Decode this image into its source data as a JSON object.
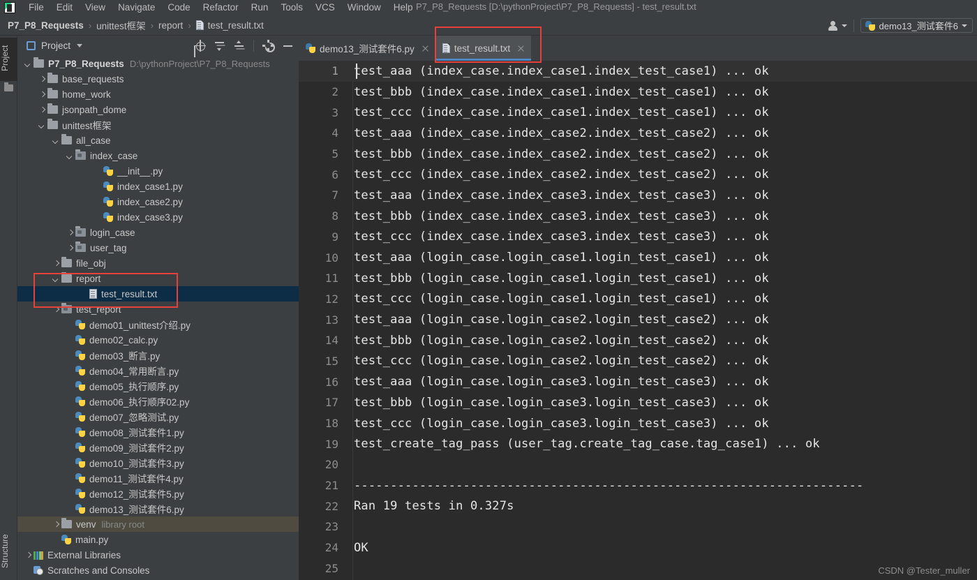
{
  "window": {
    "title": "P7_P8_Requests [D:\\pythonProject\\P7_P8_Requests] - test_result.txt",
    "logo_icon": "pycharm-logo-icon"
  },
  "menubar": {
    "items": [
      {
        "label": "File",
        "mnemonic": "F"
      },
      {
        "label": "Edit",
        "mnemonic": "E"
      },
      {
        "label": "View",
        "mnemonic": "V"
      },
      {
        "label": "Navigate",
        "mnemonic": "N"
      },
      {
        "label": "Code",
        "mnemonic": "C"
      },
      {
        "label": "Refactor",
        "mnemonic": "R"
      },
      {
        "label": "Run",
        "mnemonic": "u"
      },
      {
        "label": "Tools",
        "mnemonic": "T"
      },
      {
        "label": "VCS",
        "mnemonic": "V"
      },
      {
        "label": "Window",
        "mnemonic": "W"
      },
      {
        "label": "Help",
        "mnemonic": "H"
      }
    ]
  },
  "breadcrumb": {
    "separator": "›",
    "items": [
      {
        "label": "P7_P8_Requests",
        "bold": true
      },
      {
        "label": "unittest框架",
        "bold": false
      },
      {
        "label": "report",
        "bold": false
      },
      {
        "label": "test_result.txt",
        "bold": false,
        "icon": "text-file-icon"
      }
    ]
  },
  "toolbar_right": {
    "user_icon": "person-icon",
    "user_caret_icon": "chevron-down-icon",
    "run_config": {
      "icon": "python-file-icon",
      "label": "demo13_测试套件6",
      "caret_icon": "chevron-down-icon"
    }
  },
  "left_strip": {
    "project_tab": "Project",
    "project_tab_icon": "folder-icon",
    "structure_tab": "Structure"
  },
  "project_panel": {
    "icon": "project-view-icon",
    "title": "Project",
    "caret_icon": "chevron-down-icon",
    "actions": [
      {
        "name": "locate-icon",
        "title": "Select Opened File"
      },
      {
        "name": "expand-all-icon",
        "title": "Expand All"
      },
      {
        "name": "collapse-all-icon",
        "title": "Collapse All"
      },
      {
        "name": "gear-icon",
        "title": "Settings"
      },
      {
        "name": "minimize-icon",
        "title": "Hide"
      }
    ],
    "tree": [
      {
        "label": "P7_P8_Requests",
        "path": "D:\\pythonProject\\P7_P8_Requests",
        "indent": 0,
        "arrow": "down",
        "icon": "folder-icon",
        "bold": true,
        "state": "normal"
      },
      {
        "label": "base_requests",
        "indent": 1,
        "arrow": "right",
        "icon": "folder-icon",
        "state": "normal"
      },
      {
        "label": "home_work",
        "indent": 1,
        "arrow": "right",
        "icon": "folder-icon",
        "state": "normal"
      },
      {
        "label": "jsonpath_dome",
        "indent": 1,
        "arrow": "right",
        "icon": "folder-icon",
        "state": "normal"
      },
      {
        "label": "unittest框架",
        "indent": 1,
        "arrow": "down",
        "icon": "folder-icon",
        "state": "normal"
      },
      {
        "label": "all_case",
        "indent": 2,
        "arrow": "down",
        "icon": "folder-icon",
        "state": "normal"
      },
      {
        "label": "index_case",
        "indent": 3,
        "arrow": "down",
        "icon": "source-folder-icon",
        "state": "normal"
      },
      {
        "label": "__init__.py",
        "indent": 5,
        "arrow": "none",
        "icon": "python-file-icon",
        "state": "normal"
      },
      {
        "label": "index_case1.py",
        "indent": 5,
        "arrow": "none",
        "icon": "python-file-icon",
        "state": "normal"
      },
      {
        "label": "index_case2.py",
        "indent": 5,
        "arrow": "none",
        "icon": "python-file-icon",
        "state": "normal"
      },
      {
        "label": "index_case3.py",
        "indent": 5,
        "arrow": "none",
        "icon": "python-file-icon",
        "state": "normal"
      },
      {
        "label": "login_case",
        "indent": 3,
        "arrow": "right",
        "icon": "source-folder-icon",
        "state": "normal"
      },
      {
        "label": "user_tag",
        "indent": 3,
        "arrow": "right",
        "icon": "source-folder-icon",
        "state": "normal"
      },
      {
        "label": "file_obj",
        "indent": 2,
        "arrow": "right",
        "icon": "folder-icon",
        "state": "normal"
      },
      {
        "label": "report",
        "indent": 2,
        "arrow": "down",
        "icon": "folder-icon",
        "state": "normal"
      },
      {
        "label": "test_result.txt",
        "indent": 4,
        "arrow": "none",
        "icon": "text-file-icon",
        "state": "selected"
      },
      {
        "label": "test_report",
        "indent": 2,
        "arrow": "right",
        "icon": "source-folder-icon",
        "state": "normal"
      },
      {
        "label": "demo01_unittest介绍.py",
        "indent": 3,
        "arrow": "none",
        "icon": "python-file-icon",
        "state": "normal"
      },
      {
        "label": "demo02_calc.py",
        "indent": 3,
        "arrow": "none",
        "icon": "python-file-icon",
        "state": "normal"
      },
      {
        "label": "demo03_断言.py",
        "indent": 3,
        "arrow": "none",
        "icon": "python-file-icon",
        "state": "normal"
      },
      {
        "label": "demo04_常用断言.py",
        "indent": 3,
        "arrow": "none",
        "icon": "python-file-icon",
        "state": "normal"
      },
      {
        "label": "demo05_执行顺序.py",
        "indent": 3,
        "arrow": "none",
        "icon": "python-file-icon",
        "state": "normal"
      },
      {
        "label": "demo06_执行顺序02.py",
        "indent": 3,
        "arrow": "none",
        "icon": "python-file-icon",
        "state": "normal"
      },
      {
        "label": "demo07_忽略测试.py",
        "indent": 3,
        "arrow": "none",
        "icon": "python-file-icon",
        "state": "normal"
      },
      {
        "label": "demo08_测试套件1.py",
        "indent": 3,
        "arrow": "none",
        "icon": "python-file-icon",
        "state": "normal"
      },
      {
        "label": "demo09_测试套件2.py",
        "indent": 3,
        "arrow": "none",
        "icon": "python-file-icon",
        "state": "normal"
      },
      {
        "label": "demo10_测试套件3.py",
        "indent": 3,
        "arrow": "none",
        "icon": "python-file-icon",
        "state": "normal"
      },
      {
        "label": "demo11_测试套件4.py",
        "indent": 3,
        "arrow": "none",
        "icon": "python-file-icon",
        "state": "normal"
      },
      {
        "label": "demo12_测试套件5.py",
        "indent": 3,
        "arrow": "none",
        "icon": "python-file-icon",
        "state": "normal"
      },
      {
        "label": "demo13_测试套件6.py",
        "indent": 3,
        "arrow": "none",
        "icon": "python-file-icon",
        "state": "normal"
      },
      {
        "label": "venv",
        "path": "library root",
        "indent": 2,
        "arrow": "right",
        "icon": "folder-icon",
        "state": "hovered"
      },
      {
        "label": "main.py",
        "indent": 2,
        "arrow": "none",
        "icon": "python-file-icon",
        "state": "normal"
      },
      {
        "label": "External Libraries",
        "indent": 0,
        "arrow": "right",
        "icon": "libraries-icon",
        "state": "normal"
      },
      {
        "label": "Scratches and Consoles",
        "indent": 0,
        "arrow": "none",
        "icon": "scratches-icon",
        "state": "normal"
      }
    ]
  },
  "editor": {
    "tabs": [
      {
        "label": "demo13_测试套件6.py",
        "icon": "python-file-icon",
        "active": false,
        "close_icon": "close-icon"
      },
      {
        "label": "test_result.txt",
        "icon": "text-file-icon",
        "active": true,
        "close_icon": "close-icon"
      }
    ],
    "caret_line": 1,
    "lines": [
      {
        "n": 1,
        "text": "test_aaa (index_case.index_case1.index_test_case1) ... ok"
      },
      {
        "n": 2,
        "text": "test_bbb (index_case.index_case1.index_test_case1) ... ok"
      },
      {
        "n": 3,
        "text": "test_ccc (index_case.index_case1.index_test_case1) ... ok"
      },
      {
        "n": 4,
        "text": "test_aaa (index_case.index_case2.index_test_case2) ... ok"
      },
      {
        "n": 5,
        "text": "test_bbb (index_case.index_case2.index_test_case2) ... ok"
      },
      {
        "n": 6,
        "text": "test_ccc (index_case.index_case2.index_test_case2) ... ok"
      },
      {
        "n": 7,
        "text": "test_aaa (index_case.index_case3.index_test_case3) ... ok"
      },
      {
        "n": 8,
        "text": "test_bbb (index_case.index_case3.index_test_case3) ... ok"
      },
      {
        "n": 9,
        "text": "test_ccc (index_case.index_case3.index_test_case3) ... ok"
      },
      {
        "n": 10,
        "text": "test_aaa (login_case.login_case1.login_test_case1) ... ok"
      },
      {
        "n": 11,
        "text": "test_bbb (login_case.login_case1.login_test_case1) ... ok"
      },
      {
        "n": 12,
        "text": "test_ccc (login_case.login_case1.login_test_case1) ... ok"
      },
      {
        "n": 13,
        "text": "test_aaa (login_case.login_case2.login_test_case2) ... ok"
      },
      {
        "n": 14,
        "text": "test_bbb (login_case.login_case2.login_test_case2) ... ok"
      },
      {
        "n": 15,
        "text": "test_ccc (login_case.login_case2.login_test_case2) ... ok"
      },
      {
        "n": 16,
        "text": "test_aaa (login_case.login_case3.login_test_case3) ... ok"
      },
      {
        "n": 17,
        "text": "test_bbb (login_case.login_case3.login_test_case3) ... ok"
      },
      {
        "n": 18,
        "text": "test_ccc (login_case.login_case3.login_test_case3) ... ok"
      },
      {
        "n": 19,
        "text": "test_create_tag_pass (user_tag.create_tag_case.tag_case1) ... ok"
      },
      {
        "n": 20,
        "text": ""
      },
      {
        "n": 21,
        "text": "----------------------------------------------------------------------"
      },
      {
        "n": 22,
        "text": "Ran 19 tests in 0.327s"
      },
      {
        "n": 23,
        "text": ""
      },
      {
        "n": 24,
        "text": "OK"
      },
      {
        "n": 25,
        "text": ""
      }
    ],
    "watermark": "CSDN @Tester_muller"
  },
  "annotations": {
    "highlight_color": "#e8403a",
    "boxes": [
      {
        "name": "report-folder-highlight",
        "target": "project tree report + test_result.txt"
      },
      {
        "name": "active-tab-highlight",
        "target": "test_result.txt editor tab"
      }
    ]
  }
}
